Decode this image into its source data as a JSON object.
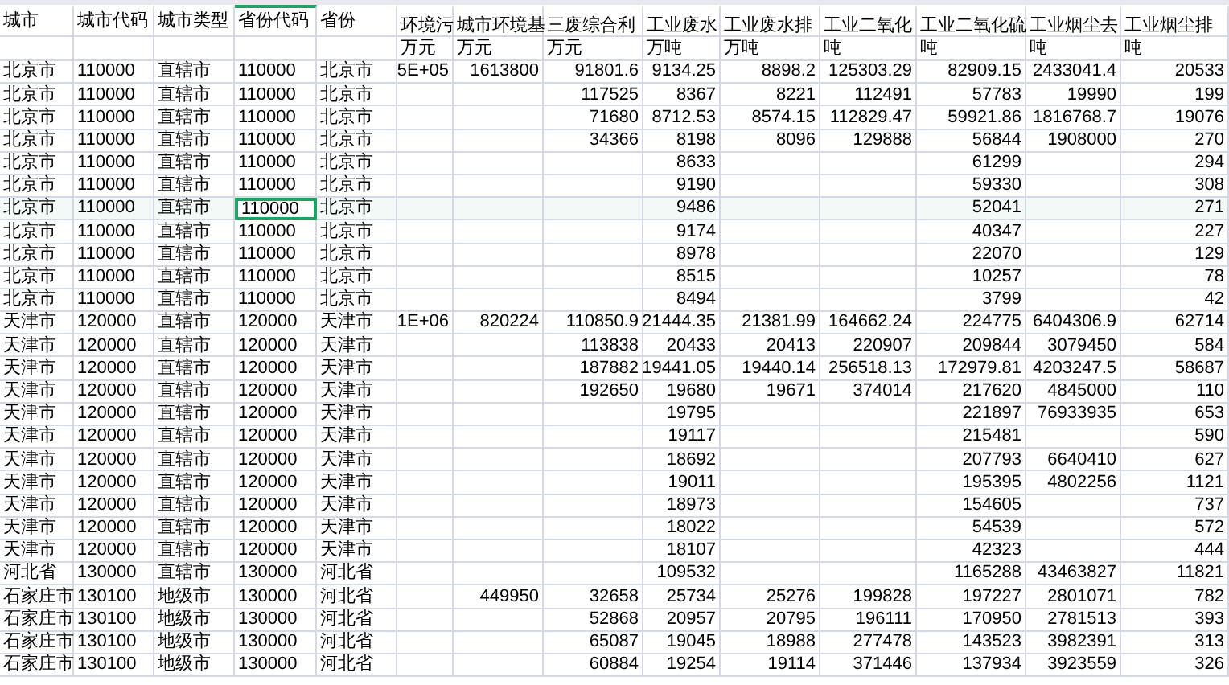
{
  "columns": [
    {
      "header": "城市",
      "kind": "text",
      "selected": false
    },
    {
      "header": "城市代码",
      "kind": "text",
      "selected": false
    },
    {
      "header": "城市类型",
      "kind": "text",
      "selected": false
    },
    {
      "header": "省份代码",
      "kind": "text",
      "selected": true
    },
    {
      "header": "省份",
      "kind": "text",
      "selected": false
    },
    {
      "header": "环境污",
      "unit": "万元",
      "kind": "number",
      "selected": false
    },
    {
      "header": "城市环境基",
      "unit": "万元",
      "kind": "number",
      "selected": false
    },
    {
      "header": "三废综合利",
      "unit": "万元",
      "kind": "number",
      "selected": false
    },
    {
      "header": "工业废水",
      "unit": "万吨",
      "kind": "number",
      "selected": false
    },
    {
      "header": "工业废水排",
      "unit": "万吨",
      "kind": "number",
      "selected": false
    },
    {
      "header": "工业二氧化",
      "unit": "吨",
      "kind": "number",
      "selected": false
    },
    {
      "header": "工业二氧化硫",
      "unit": "吨",
      "kind": "number",
      "selected": false
    },
    {
      "header": "工业烟尘去",
      "unit": "吨",
      "kind": "number",
      "selected": false
    },
    {
      "header": "工业烟尘排",
      "unit": "吨",
      "kind": "number",
      "selected": false
    }
  ],
  "rows": [
    {
      "selected": false,
      "cells": [
        "北京市",
        "110000",
        "直辖市",
        "110000",
        "北京市",
        "5E+05",
        "1613800",
        "91801.6",
        "9134.25",
        "8898.2",
        "125303.29",
        "82909.15",
        "2433041.4",
        "20533"
      ]
    },
    {
      "selected": false,
      "cells": [
        "北京市",
        "110000",
        "直辖市",
        "110000",
        "北京市",
        null,
        null,
        "117525",
        "8367",
        "8221",
        "112491",
        "57783",
        "19990",
        "199"
      ]
    },
    {
      "selected": false,
      "cells": [
        "北京市",
        "110000",
        "直辖市",
        "110000",
        "北京市",
        null,
        null,
        "71680",
        "8712.53",
        "8574.15",
        "112829.47",
        "59921.86",
        "1816768.7",
        "19076"
      ]
    },
    {
      "selected": false,
      "cells": [
        "北京市",
        "110000",
        "直辖市",
        "110000",
        "北京市",
        null,
        null,
        "34366",
        "8198",
        "8096",
        "129888",
        "56844",
        "1908000",
        "270"
      ]
    },
    {
      "selected": false,
      "cells": [
        "北京市",
        "110000",
        "直辖市",
        "110000",
        "北京市",
        null,
        null,
        null,
        "8633",
        null,
        null,
        "61299",
        null,
        "294"
      ]
    },
    {
      "selected": false,
      "cells": [
        "北京市",
        "110000",
        "直辖市",
        "110000",
        "北京市",
        null,
        null,
        null,
        "9190",
        null,
        null,
        "59330",
        null,
        "308"
      ]
    },
    {
      "selected": true,
      "cells": [
        "北京市",
        "110000",
        "直辖市",
        "110000",
        "北京市",
        null,
        null,
        null,
        "9486",
        null,
        null,
        "52041",
        null,
        "271"
      ]
    },
    {
      "selected": false,
      "cells": [
        "北京市",
        "110000",
        "直辖市",
        "110000",
        "北京市",
        null,
        null,
        null,
        "9174",
        null,
        null,
        "40347",
        null,
        "227"
      ]
    },
    {
      "selected": false,
      "cells": [
        "北京市",
        "110000",
        "直辖市",
        "110000",
        "北京市",
        null,
        null,
        null,
        "8978",
        null,
        null,
        "22070",
        null,
        "129"
      ]
    },
    {
      "selected": false,
      "cells": [
        "北京市",
        "110000",
        "直辖市",
        "110000",
        "北京市",
        null,
        null,
        null,
        "8515",
        null,
        null,
        "10257",
        null,
        "78"
      ]
    },
    {
      "selected": false,
      "cells": [
        "北京市",
        "110000",
        "直辖市",
        "110000",
        "北京市",
        null,
        null,
        null,
        "8494",
        null,
        null,
        "3799",
        null,
        "42"
      ]
    },
    {
      "selected": false,
      "cells": [
        "天津市",
        "120000",
        "直辖市",
        "120000",
        "天津市",
        "1E+06",
        "820224",
        "110850.9",
        "21444.35",
        "21381.99",
        "164662.24",
        "224775",
        "6404306.9",
        "62714"
      ]
    },
    {
      "selected": false,
      "cells": [
        "天津市",
        "120000",
        "直辖市",
        "120000",
        "天津市",
        null,
        null,
        "113838",
        "20433",
        "20413",
        "220907",
        "209844",
        "3079450",
        "584"
      ]
    },
    {
      "selected": false,
      "cells": [
        "天津市",
        "120000",
        "直辖市",
        "120000",
        "天津市",
        null,
        null,
        "187882",
        "19441.05",
        "19440.14",
        "256518.13",
        "172979.81",
        "4203247.5",
        "58687"
      ]
    },
    {
      "selected": false,
      "cells": [
        "天津市",
        "120000",
        "直辖市",
        "120000",
        "天津市",
        null,
        null,
        "192650",
        "19680",
        "19671",
        "374014",
        "217620",
        "4845000",
        "110"
      ]
    },
    {
      "selected": false,
      "cells": [
        "天津市",
        "120000",
        "直辖市",
        "120000",
        "天津市",
        null,
        null,
        null,
        "19795",
        null,
        null,
        "221897",
        "76933935",
        "653"
      ]
    },
    {
      "selected": false,
      "cells": [
        "天津市",
        "120000",
        "直辖市",
        "120000",
        "天津市",
        null,
        null,
        null,
        "19117",
        null,
        null,
        "215481",
        null,
        "590"
      ]
    },
    {
      "selected": false,
      "cells": [
        "天津市",
        "120000",
        "直辖市",
        "120000",
        "天津市",
        null,
        null,
        null,
        "18692",
        null,
        null,
        "207793",
        "6640410",
        "627"
      ]
    },
    {
      "selected": false,
      "cells": [
        "天津市",
        "120000",
        "直辖市",
        "120000",
        "天津市",
        null,
        null,
        null,
        "19011",
        null,
        null,
        "195395",
        "4802256",
        "1121"
      ]
    },
    {
      "selected": false,
      "cells": [
        "天津市",
        "120000",
        "直辖市",
        "120000",
        "天津市",
        null,
        null,
        null,
        "18973",
        null,
        null,
        "154605",
        null,
        "737"
      ]
    },
    {
      "selected": false,
      "cells": [
        "天津市",
        "120000",
        "直辖市",
        "120000",
        "天津市",
        null,
        null,
        null,
        "18022",
        null,
        null,
        "54539",
        null,
        "572"
      ]
    },
    {
      "selected": false,
      "cells": [
        "天津市",
        "120000",
        "直辖市",
        "120000",
        "天津市",
        null,
        null,
        null,
        "18107",
        null,
        null,
        "42323",
        null,
        "444"
      ]
    },
    {
      "selected": false,
      "cells": [
        "河北省",
        "130000",
        "直辖市",
        "130000",
        "河北省",
        null,
        null,
        null,
        "109532",
        null,
        null,
        "1165288",
        "43463827",
        "11821"
      ]
    },
    {
      "selected": false,
      "cells": [
        "石家庄市",
        "130100",
        "地级市",
        "130000",
        "河北省",
        null,
        "449950",
        "32658",
        "25734",
        "25276",
        "199828",
        "197227",
        "2801071",
        "782"
      ]
    },
    {
      "selected": false,
      "cells": [
        "石家庄市",
        "130100",
        "地级市",
        "130000",
        "河北省",
        null,
        null,
        "52868",
        "20957",
        "20795",
        "196111",
        "170950",
        "2781513",
        "393"
      ]
    },
    {
      "selected": false,
      "cells": [
        "石家庄市",
        "130100",
        "地级市",
        "130000",
        "河北省",
        null,
        null,
        "65087",
        "19045",
        "18988",
        "277478",
        "143523",
        "3982391",
        "313"
      ]
    },
    {
      "selected": false,
      "cells": [
        "石家庄市",
        "130100",
        "地级市",
        "130000",
        "河北省",
        null,
        null,
        "60884",
        "19254",
        "19114",
        "371446",
        "137934",
        "3923559",
        "326"
      ]
    }
  ]
}
